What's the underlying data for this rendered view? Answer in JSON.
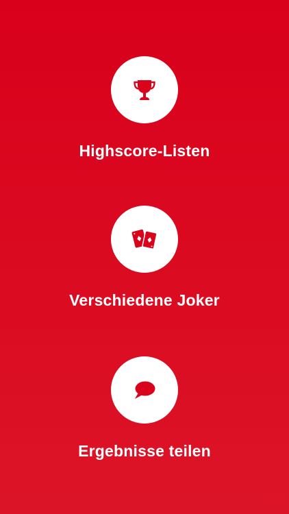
{
  "colors": {
    "background": "#DA0A20",
    "icon": "#D9041C",
    "circle": "#FFFFFF",
    "text": "#FFFFFF"
  },
  "features": [
    {
      "icon": "trophy-icon",
      "label": "Highscore-Listen"
    },
    {
      "icon": "cards-icon",
      "label": "Verschiedene Joker"
    },
    {
      "icon": "speech-bubble-icon",
      "label": "Ergebnisse teilen"
    }
  ]
}
